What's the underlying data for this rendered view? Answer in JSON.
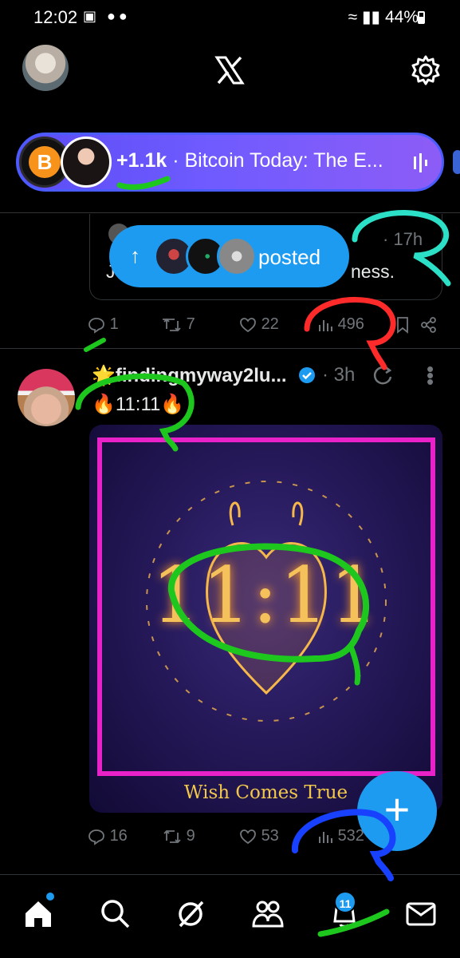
{
  "status_bar": {
    "time": "12:02",
    "battery": "44%"
  },
  "header": {
    "avatar": "profile-avatar",
    "logo": "X",
    "settings_icon": "gear-icon"
  },
  "spaces_pill": {
    "listeners": "+1.1k",
    "separator": "·",
    "title": "Bitcoin Today:  The E..."
  },
  "quoted_tweet": {
    "time": "· 17h",
    "text_left": "J",
    "text_right": "ness."
  },
  "posted_pill": {
    "label": "posted"
  },
  "tweet1_actions": {
    "replies": "1",
    "reposts": "7",
    "likes": "22",
    "views": "496"
  },
  "tweet2": {
    "author": "🌟findingmyway2lu...",
    "time": "· 3h",
    "text": "🔥11:11🔥",
    "media_main_text": "11:11",
    "media_caption": "Wish Comes True",
    "actions": {
      "replies": "16",
      "reposts": "9",
      "likes": "53",
      "views": "532"
    }
  },
  "fab": {
    "label": "+"
  },
  "bottom_nav": {
    "items": [
      "home-icon",
      "search-icon",
      "grok-icon",
      "communities-icon",
      "notifications-icon",
      "messages-icon"
    ],
    "notifications_badge": "11"
  },
  "colors": {
    "accent": "#1d9bf0",
    "spaces_gradient_start": "#5b4df5",
    "spaces_gradient_end": "#8d5cf6",
    "media_frame": "#e821c8"
  }
}
